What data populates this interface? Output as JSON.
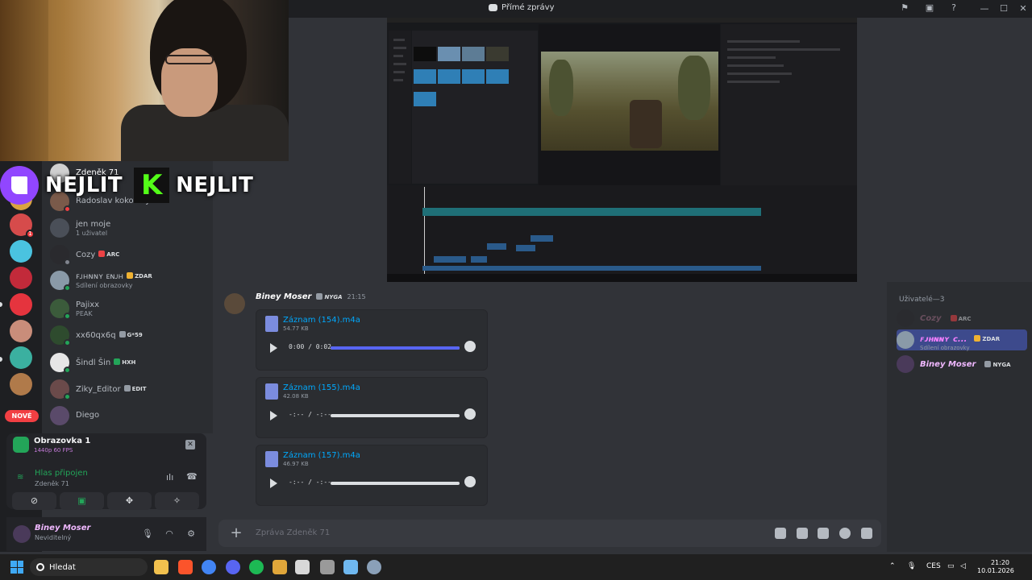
{
  "window": {
    "title": "Přímé zprávy"
  },
  "overlay": {
    "left_text": "NEJLIT",
    "right_text": "NEJLIT",
    "kick_glyph": "K"
  },
  "dm_list": [
    {
      "name": "Zdeněk 71",
      "sub": ""
    },
    {
      "name": "Radoslav kokotský",
      "sub": ""
    },
    {
      "name": "jen moje",
      "sub": "1 uživatel"
    },
    {
      "name": "Cozy",
      "sub": "",
      "tag": "ARC"
    },
    {
      "name": "ꜰᴊʜɴɴʏ ᴇɴᴊʜ",
      "sub": "Sdílení obrazovky",
      "tag": "ZDAR"
    },
    {
      "name": "Pajixx",
      "sub": "PEAK"
    },
    {
      "name": "xx60qx6q",
      "sub": "",
      "tag": "G*59"
    },
    {
      "name": "Šindl Šin",
      "sub": "",
      "tag": "HXH"
    },
    {
      "name": "Ziky_Editor",
      "sub": "",
      "tag": "EDIT"
    },
    {
      "name": "Diego",
      "sub": ""
    }
  ],
  "guilds": {
    "new_label": "NOVÉ",
    "badge_count": "1"
  },
  "stream_panel": {
    "title": "Obrazovka 1",
    "quality": "1440p 60 FPS"
  },
  "voice": {
    "status": "Hlas připojen",
    "channel": "Zdeněk 71"
  },
  "user": {
    "name": "Biney Moser",
    "status": "Neviditelný"
  },
  "message": {
    "author": "Biney Moser",
    "tag": "NYGA",
    "time": "21:15",
    "attachments": [
      {
        "file": "Záznam (154).m4a",
        "size": "54.77 KB",
        "time": "0:00 / 0:02",
        "progress": 1.0
      },
      {
        "file": "Záznam (155).m4a",
        "size": "42.08 KB",
        "time": "-:-- / -:--",
        "progress": 0.0
      },
      {
        "file": "Záznam (157).m4a",
        "size": "46.97 KB",
        "time": "-:-- / -:--",
        "progress": 0.0
      }
    ]
  },
  "composer": {
    "placeholder": "Zpráva Zdeněk 71"
  },
  "members": {
    "header": "Uživatelé—3",
    "list": [
      {
        "name": "Cozy",
        "tag": "ARC",
        "sub": "",
        "color": "#9a6a82"
      },
      {
        "name": "ꜰᴊʜɴɴʏ ᴄ...",
        "tag": "ZDAR",
        "sub": "Sdílení obrazovky",
        "color": "#f47fff"
      },
      {
        "name": "Biney Moser",
        "tag": "NYGA",
        "sub": "",
        "color": "#f0b8ff"
      }
    ]
  },
  "taskbar": {
    "search_label": "Hledat",
    "lang": "CES",
    "time": "21:20",
    "date": "10.01.2026"
  },
  "icons": [
    "inbox-icon",
    "screen-icon",
    "help-icon",
    "minimize-icon",
    "maximize-icon",
    "close-icon",
    "mic-icon",
    "headphones-icon",
    "settings-icon",
    "gift-icon",
    "gif-icon",
    "sticker-icon",
    "emoji-icon",
    "apps-icon"
  ]
}
